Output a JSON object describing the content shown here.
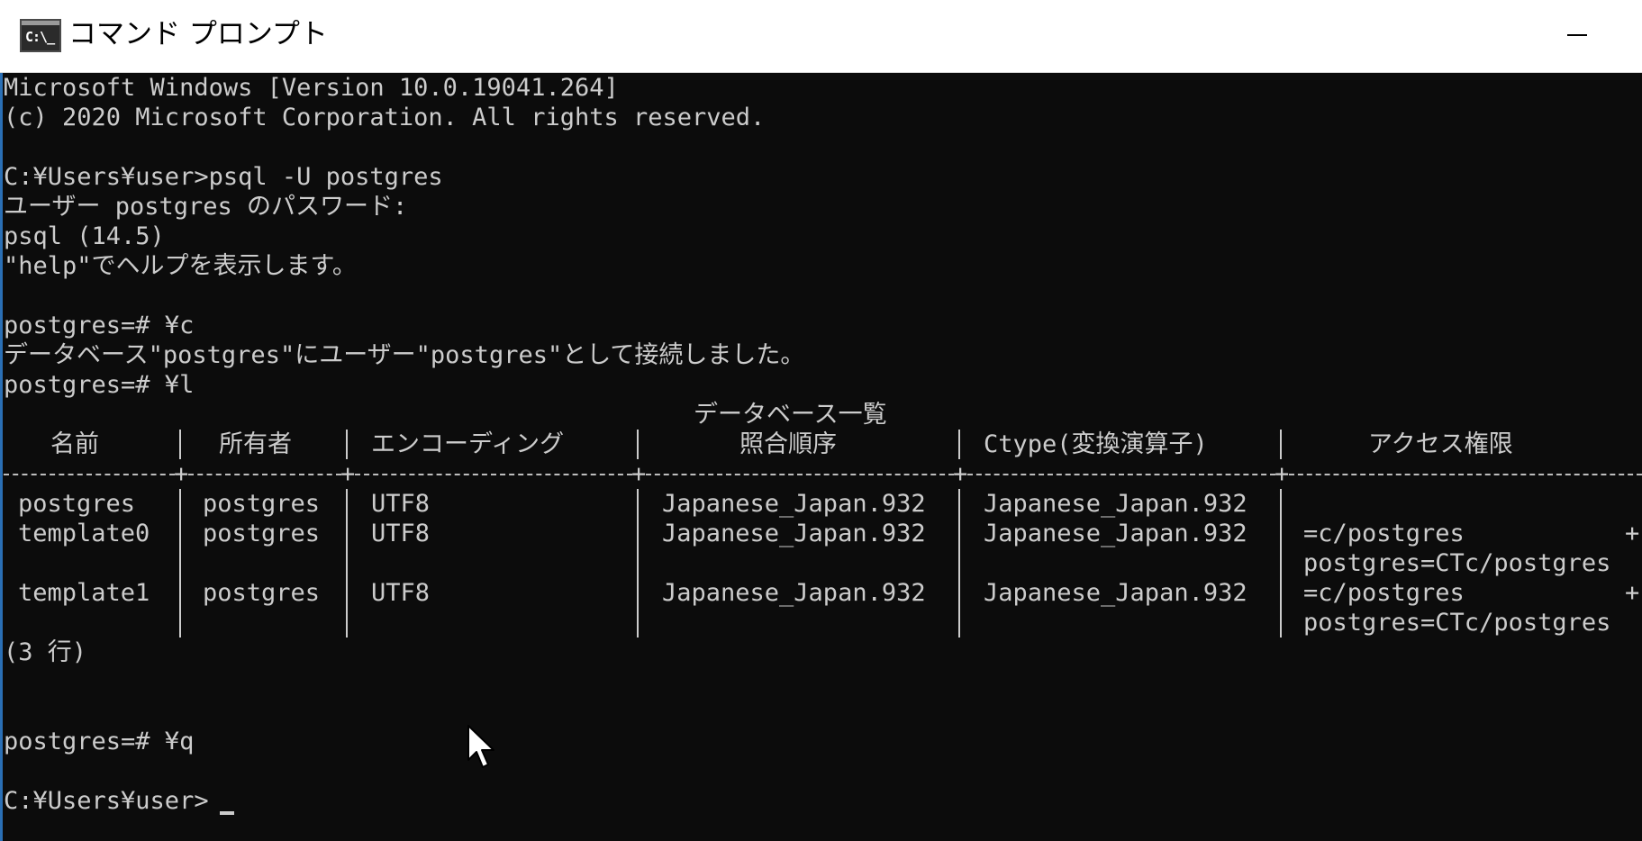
{
  "window": {
    "title": "コマンド プロンプト",
    "icon_glyph": "C:\\_"
  },
  "console": {
    "lines": {
      "l1": "Microsoft Windows [Version 10.0.19041.264]",
      "l2": "(c) 2020 Microsoft Corporation. All rights reserved.",
      "l3": "C:¥Users¥user>psql -U postgres",
      "l4": "ユーザー postgres のパスワード:",
      "l5": "psql (14.5)",
      "l6": "\"help\"でヘルプを表示します。",
      "l7": "postgres=# ¥c",
      "l8": "データベース\"postgres\"にユーザー\"postgres\"として接続しました。",
      "l9": "postgres=# ¥l",
      "rowcount": "(3 行)",
      "l10": "postgres=# ¥q",
      "prompt": "C:¥Users¥user>"
    },
    "table": {
      "title": "データベース一覧",
      "headers": [
        "名前",
        "所有者",
        "エンコーディング",
        "照合順序",
        "Ctype(変換演算子)",
        "アクセス権限"
      ],
      "rows": [
        {
          "name": "postgres",
          "owner": "postgres",
          "encoding": "UTF8",
          "collate": "Japanese_Japan.932",
          "ctype": "Japanese_Japan.932",
          "acl1": "",
          "acl1_plus": "",
          "acl2": ""
        },
        {
          "name": "template0",
          "owner": "postgres",
          "encoding": "UTF8",
          "collate": "Japanese_Japan.932",
          "ctype": "Japanese_Japan.932",
          "acl1": "=c/postgres",
          "acl1_plus": "+",
          "acl2": "postgres=CTc/postgres"
        },
        {
          "name": "template1",
          "owner": "postgres",
          "encoding": "UTF8",
          "collate": "Japanese_Japan.932",
          "ctype": "Japanese_Japan.932",
          "acl1": "=c/postgres",
          "acl1_plus": "+",
          "acl2": "postgres=CTc/postgres"
        }
      ]
    }
  },
  "colors": {
    "console_bg": "#0c0c0c",
    "console_fg": "#cccccc",
    "titlebar_bg": "#ffffff"
  },
  "icons": {
    "app": "cmd-app-icon",
    "minimize": "minimize-icon",
    "pointer": "mouse-pointer-icon"
  }
}
